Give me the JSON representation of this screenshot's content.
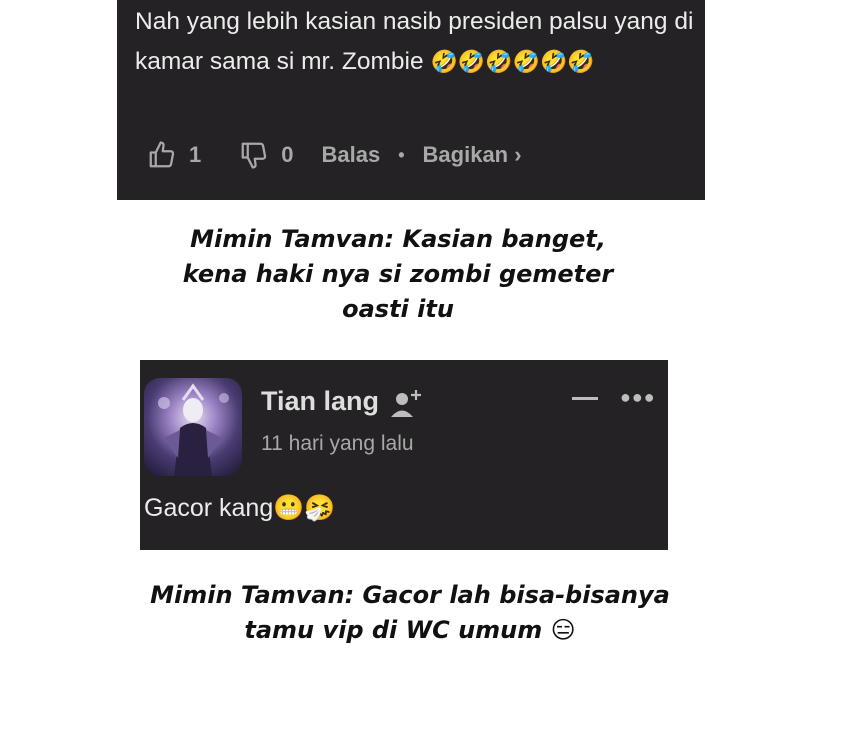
{
  "comment1": {
    "text": "Nah yang lebih kasian nasib presiden palsu yang di kamar sama si mr. Zombie",
    "emojis": "🤣🤣🤣🤣🤣🤣",
    "like_count": "1",
    "dislike_count": "0",
    "reply_label": "Balas",
    "separator": "•",
    "share_label": "Bagikan ›",
    "icons": [
      "thumbs-up-icon",
      "thumbs-down-icon"
    ]
  },
  "caption1": {
    "line1": "Mimin Tamvan: Kasian banget,",
    "line2": "kena haki nya si zombi gemeter",
    "line3": "oasti itu"
  },
  "comment2": {
    "username": "Tian lang",
    "time_ago": "11 hari yang lalu",
    "text": "Gacor kang",
    "emojis": "😬🤧",
    "icons": [
      "avatar",
      "add-user-icon",
      "minimize-icon",
      "more-icon"
    ]
  },
  "caption2": {
    "line1": "Mimin Tamvan: Gacor lah bisa-bisanya",
    "line2": "tamu vip di WC umum 😑"
  },
  "colors": {
    "card_bg": "#242224",
    "text": "#ececec",
    "muted": "#a8a8a8",
    "caption": "#111111"
  }
}
